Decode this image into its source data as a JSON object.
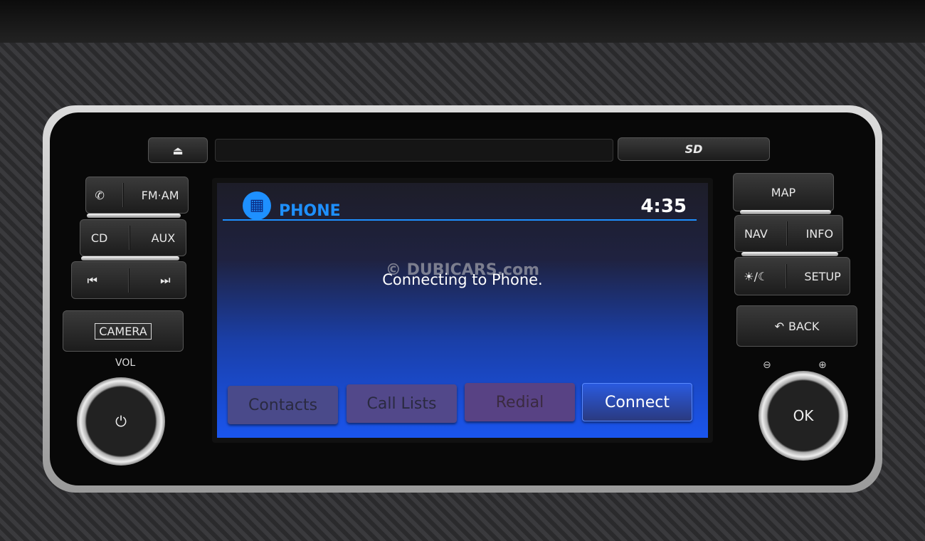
{
  "head_unit": {
    "eject_label": "⏏",
    "sd_label": "SD",
    "left": {
      "phone_icon": "phone-handset-icon",
      "fm_am": "FM·AM",
      "cd": "CD",
      "aux": "AUX",
      "prev": "⏮",
      "next": "⏭",
      "camera": "CAMERA",
      "vol": "VOL",
      "power_icon": "⏻"
    },
    "right": {
      "map": "MAP",
      "nav": "NAV",
      "info": "INFO",
      "day_night": "☀/☾",
      "setup": "SETUP",
      "back": "BACK",
      "back_icon": "↶",
      "zoom_out": "⊖",
      "zoom_in": "⊕",
      "ok": "OK"
    }
  },
  "screen": {
    "title": "PHONE",
    "time": "4:35",
    "message": "Connecting to Phone.",
    "watermark": "© DUBICARS.com",
    "accent": "#1e90ff",
    "buttons": [
      {
        "label": "Contacts"
      },
      {
        "label": "Call Lists"
      },
      {
        "label": "Redial"
      },
      {
        "label": "Connect"
      }
    ]
  }
}
